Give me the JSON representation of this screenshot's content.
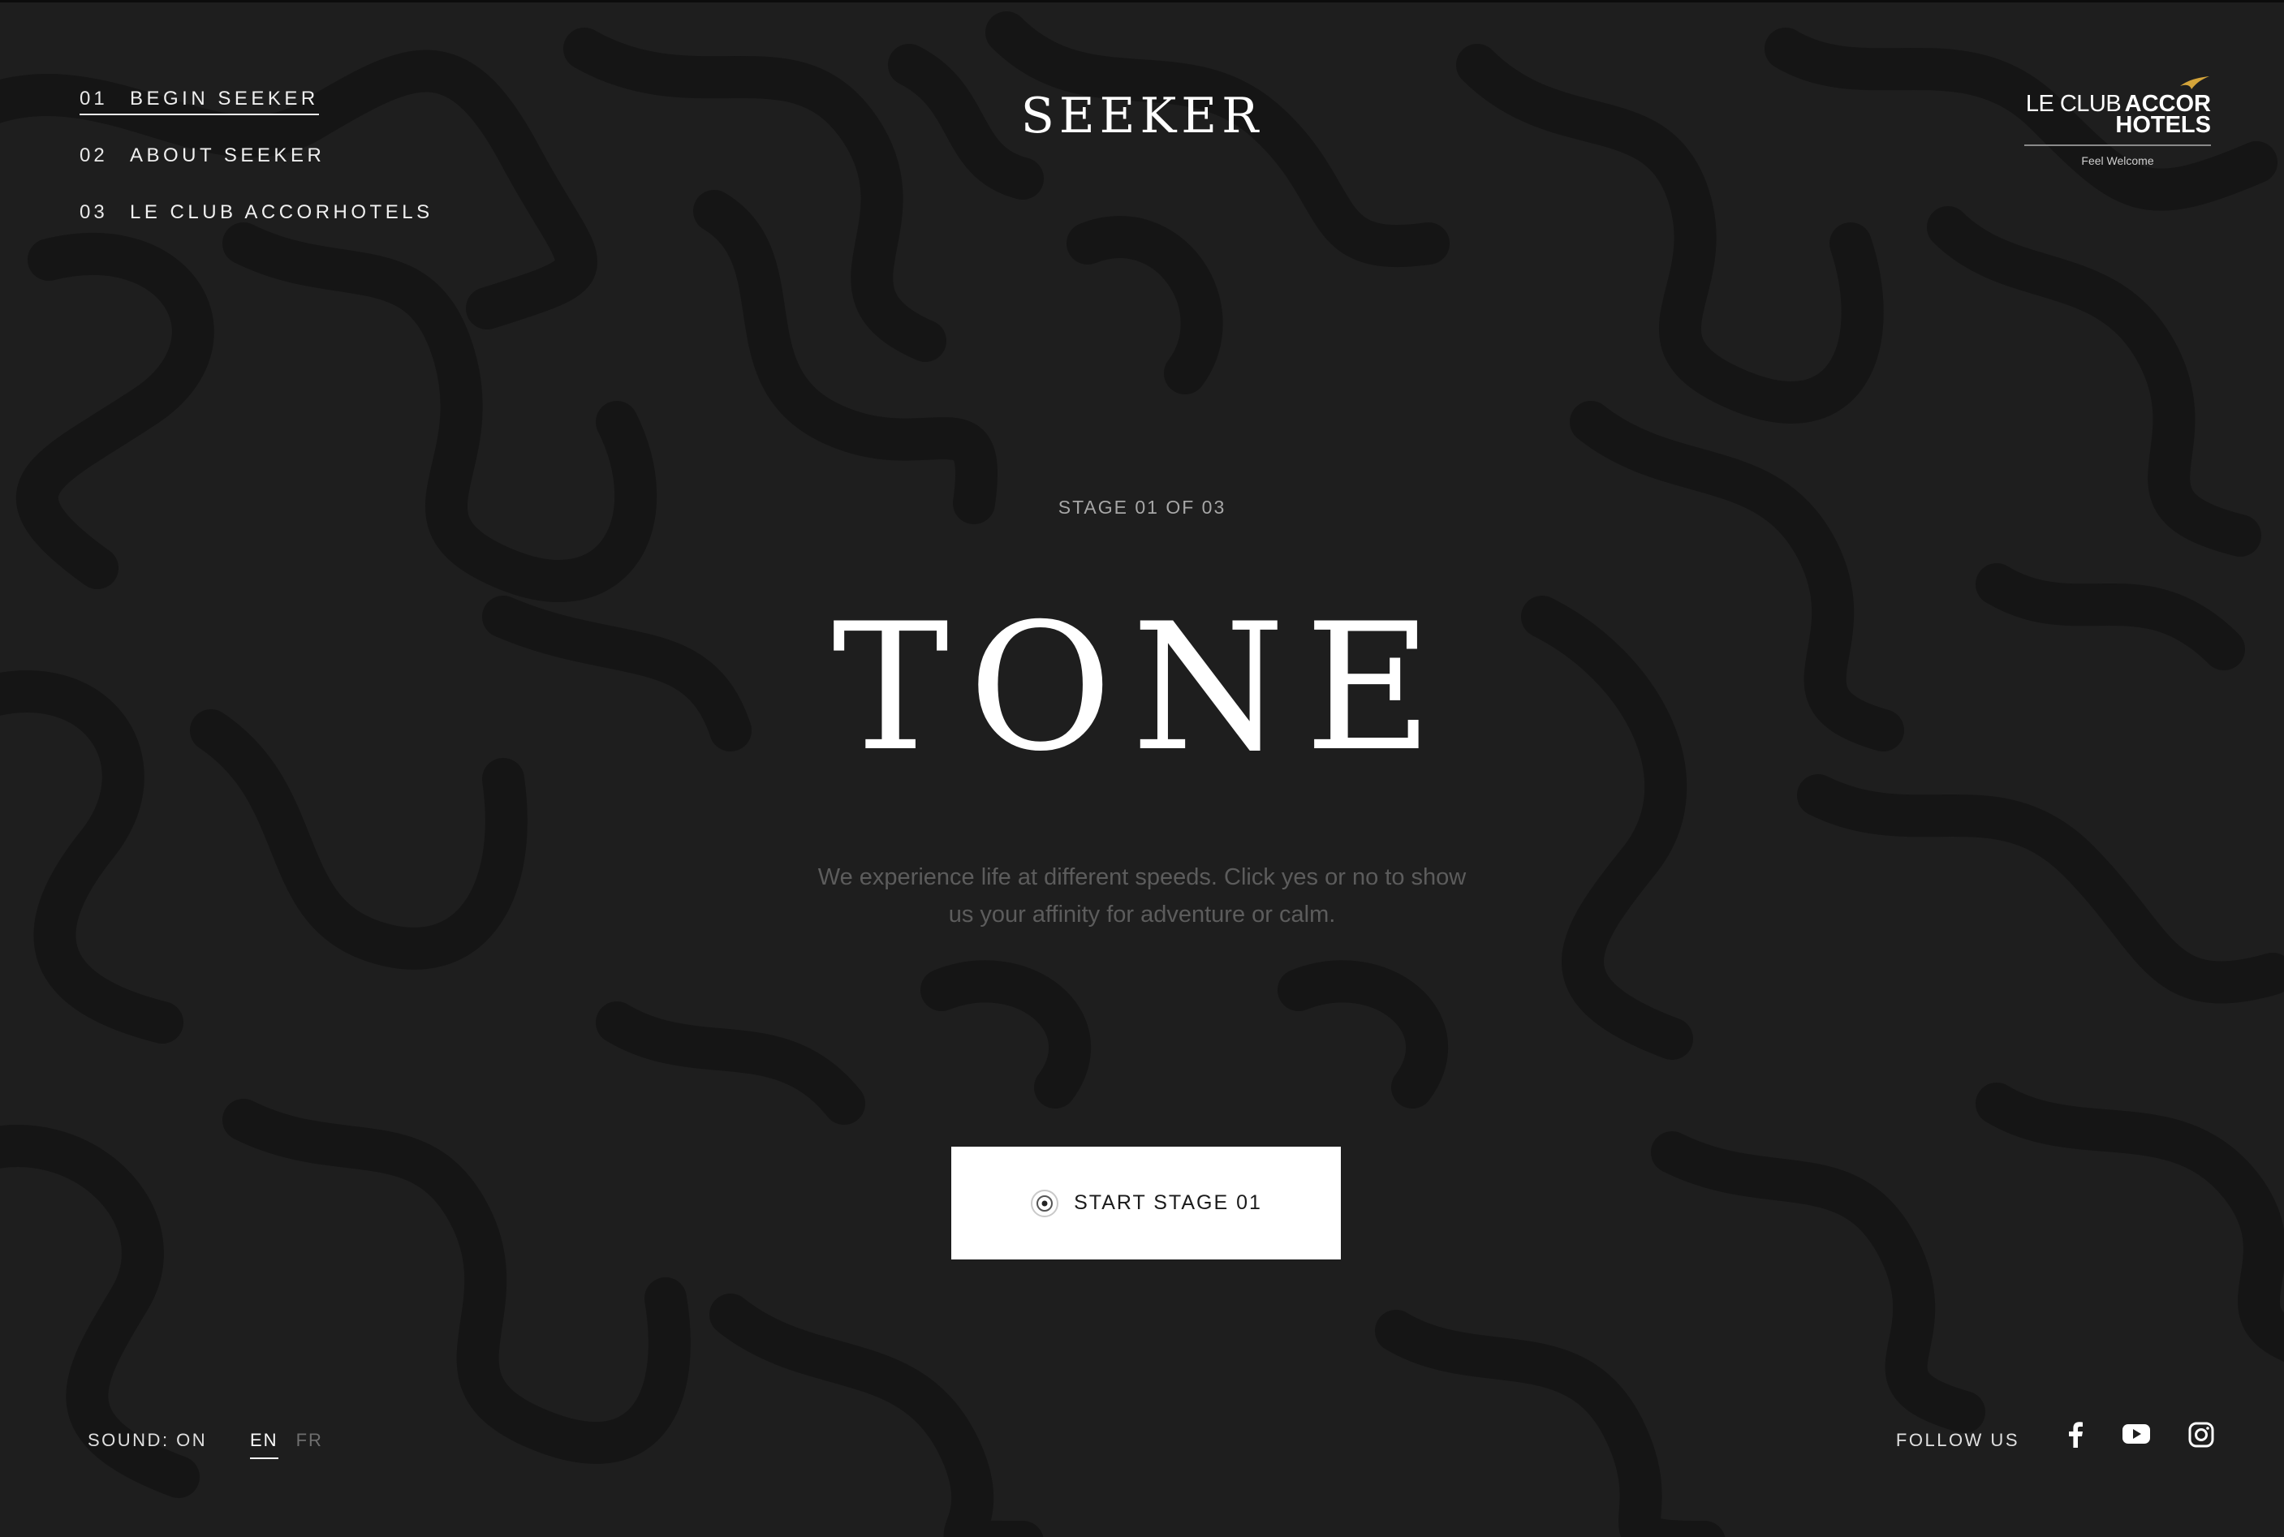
{
  "nav": {
    "items": [
      {
        "num": "01",
        "label": "BEGIN SEEKER",
        "active": true
      },
      {
        "num": "02",
        "label": "ABOUT SEEKER",
        "active": false
      },
      {
        "num": "03",
        "label": "LE CLUB ACCORHOTELS",
        "active": false
      }
    ]
  },
  "logo": {
    "text": "SEEKER"
  },
  "brand": {
    "le_club": "LE CLUB",
    "accor": "ACCOR",
    "hotels": "HOTELS",
    "tagline": "Feel Welcome",
    "bird_color": "#d4a43a"
  },
  "stage": {
    "label": "STAGE 01 OF 03",
    "title": "TONE",
    "description": "We experience life at different speeds. Click yes or no to show us your affinity for adventure or calm.",
    "cta_label": "START STAGE 01"
  },
  "footer": {
    "sound": "SOUND: ON",
    "languages": [
      {
        "code": "EN",
        "active": true
      },
      {
        "code": "FR",
        "active": false
      }
    ],
    "follow_label": "FOLLOW US",
    "social": [
      "facebook-icon",
      "youtube-icon",
      "instagram-icon"
    ]
  },
  "colors": {
    "background": "#1e1e1e",
    "pattern": "#141414",
    "text": "#ffffff",
    "muted": "#5c5c5c",
    "accent": "#d4a43a"
  }
}
